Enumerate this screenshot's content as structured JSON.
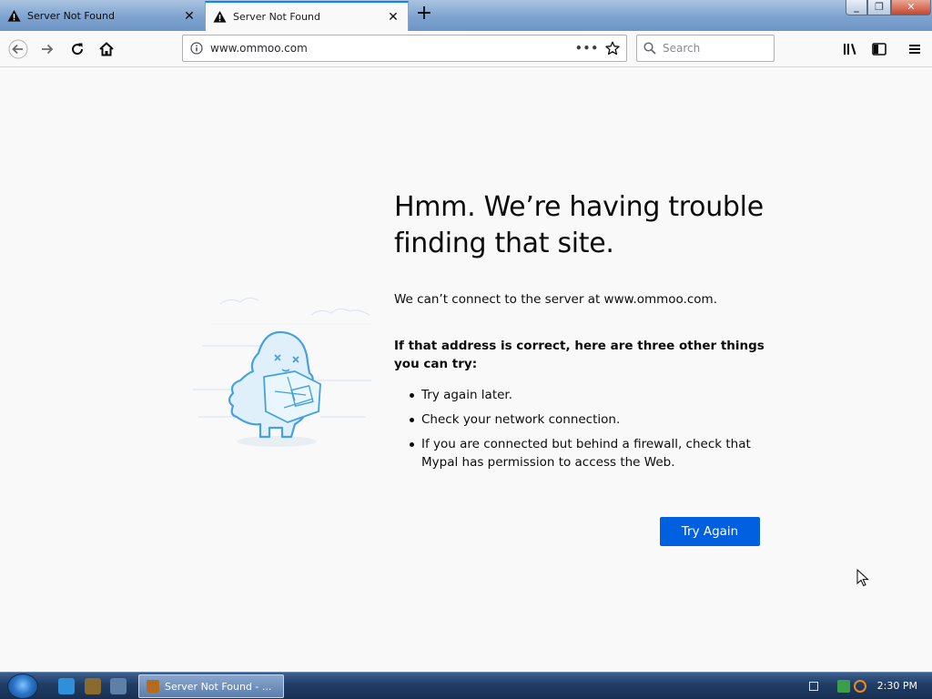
{
  "tabs": [
    {
      "label": "Server Not Found",
      "active": false
    },
    {
      "label": "Server Not Found",
      "active": true
    }
  ],
  "toolbar": {
    "url": "www.ommoo.com",
    "more_label": "•••",
    "search_placeholder": "Search"
  },
  "error": {
    "title": "Hmm. We’re having trouble finding that site.",
    "description": "We can’t connect to the server at www.ommoo.com.",
    "tips_heading": "If that address is correct, here are three other things you can try:",
    "tips": [
      "Try again later.",
      "Check your network connection.",
      "If you are connected but behind a firewall, check that Mypal has permission to access the Web."
    ],
    "button_label": "Try Again"
  },
  "taskbar": {
    "task_label": "Server Not Found - ...",
    "clock": "2:30 PM"
  },
  "colors": {
    "accent": "#0060df",
    "tab_highlight": "#0a84ff",
    "illustration": "#45a1dc"
  }
}
